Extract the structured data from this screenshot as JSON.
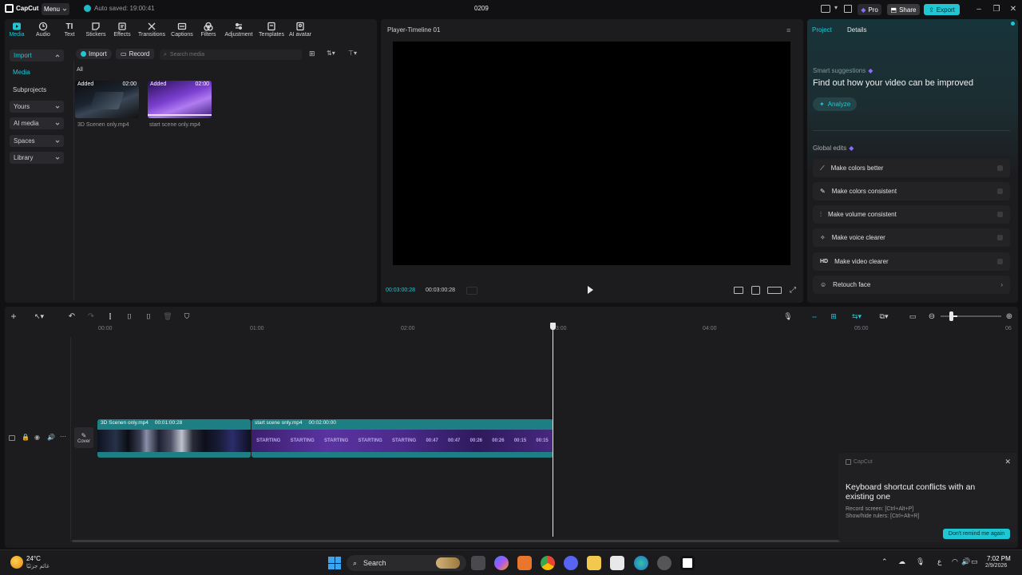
{
  "titlebar": {
    "app_name": "CapCut",
    "menu_label": "Menu",
    "autosave": "Auto saved: 19:00:41",
    "project_name": "0209",
    "pro_label": "Pro",
    "share_label": "Share",
    "export_label": "Export"
  },
  "toolbar": {
    "tools": [
      {
        "label": "Media",
        "icon": "media-icon"
      },
      {
        "label": "Audio",
        "icon": "audio-icon"
      },
      {
        "label": "Text",
        "icon": "text-icon"
      },
      {
        "label": "Stickers",
        "icon": "stickers-icon"
      },
      {
        "label": "Effects",
        "icon": "effects-icon"
      },
      {
        "label": "Transitions",
        "icon": "transitions-icon"
      },
      {
        "label": "Captions",
        "icon": "captions-icon"
      },
      {
        "label": "Filters",
        "icon": "filters-icon"
      },
      {
        "label": "Adjustment",
        "icon": "adjustment-icon"
      },
      {
        "label": "Templates",
        "icon": "templates-icon"
      },
      {
        "label": "AI avatar",
        "icon": "ai-avatar-icon"
      }
    ]
  },
  "left_nav": {
    "import": "Import",
    "media": "Media",
    "subprojects": "Subprojects",
    "yours": "Yours",
    "ai_media": "AI media",
    "spaces": "Spaces",
    "library": "Library"
  },
  "media_bar": {
    "import_btn": "Import",
    "record_btn": "Record",
    "search_placeholder": "Search media",
    "filter_all": "All"
  },
  "media_items": [
    {
      "badge": "Added",
      "duration": "02:00",
      "name": "3D Scenen only.mp4"
    },
    {
      "badge": "Added",
      "duration": "02:00",
      "name": "start scene only.mp4"
    }
  ],
  "player": {
    "title": "Player-Timeline 01",
    "current_time": "00:03:00:28",
    "total_time": "00:03:00:28"
  },
  "right_panel": {
    "tab_project": "Project",
    "tab_details": "Details",
    "smart_title": "Smart suggestions",
    "smart_subtitle": "Find out how your video can be improved",
    "analyze_label": "Analyze",
    "global_edits_title": "Global edits",
    "edits": [
      {
        "label": "Make colors better",
        "icon": "magic-wand-icon"
      },
      {
        "label": "Make colors consistent",
        "icon": "color-brush-icon"
      },
      {
        "label": "Make volume consistent",
        "icon": "equalizer-icon"
      },
      {
        "label": "Make voice clearer",
        "icon": "sparkle-voice-icon"
      },
      {
        "label": "Make video clearer",
        "icon": "hd-icon"
      },
      {
        "label": "Retouch face",
        "icon": "face-icon"
      }
    ]
  },
  "timeline": {
    "ruler": [
      "00:00",
      "01:00",
      "02:00",
      "03:00",
      "04:00",
      "05:00",
      "06"
    ],
    "cover_label": "Cover",
    "clip1_name": "3D Scenen only.mp4",
    "clip1_duration": "00:01:00:28",
    "clip2_name": "start scene only.mp4",
    "clip2_duration": "00:02:00:00",
    "frame_texts": [
      "STARTING",
      "STARTING",
      "STARTING",
      "STARTING",
      "STARTING",
      "00:47",
      "00:47",
      "00:26",
      "00:26",
      "00:15",
      "00:15"
    ]
  },
  "popup": {
    "app": "CapCut",
    "title": "Keyboard shortcut conflicts with an existing one",
    "line1": "Record screen: [Ctrl+Alt+P]",
    "line2": "Show/hide rulers: [Ctrl+Alt+R]",
    "button": "Don't remind me again"
  },
  "taskbar": {
    "temperature": "24°C",
    "weather_text": "غائم جزئيًا",
    "search_label": "Search",
    "time": "7:02 PM",
    "date": "2/9/2026",
    "lang": "ع"
  },
  "colors": {
    "accent": "#1fc7d4",
    "clip_teal": "#1d7f83",
    "pro_purple": "#8b6cff"
  }
}
